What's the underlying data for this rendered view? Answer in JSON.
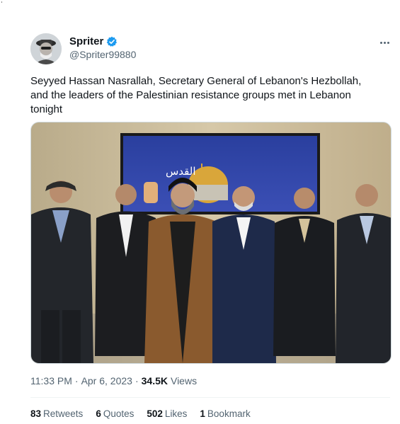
{
  "author": {
    "display_name": "Spriter",
    "handle": "@Spriter99880",
    "verified": true,
    "verified_color": "#1d9bf0"
  },
  "tweet": {
    "text": "Seyyed Hassan Nasrallah, Secretary General of Lebanon's Hezbollah,\nand the leaders of the Palestinian resistance groups met in Lebanon\ntonight",
    "image_banner_text": "القدس",
    "time": "11:33 PM",
    "date": "Apr 6, 2023",
    "views_count": "34.5K",
    "views_label": "Views"
  },
  "stats": {
    "retweets_count": "83",
    "retweets_label": "Retweets",
    "quotes_count": "6",
    "quotes_label": "Quotes",
    "likes_count": "502",
    "likes_label": "Likes",
    "bookmarks_count": "1",
    "bookmarks_label": "Bookmark"
  },
  "icons": {
    "more": "more-horizontal-icon",
    "verified": "verified-badge-icon"
  }
}
